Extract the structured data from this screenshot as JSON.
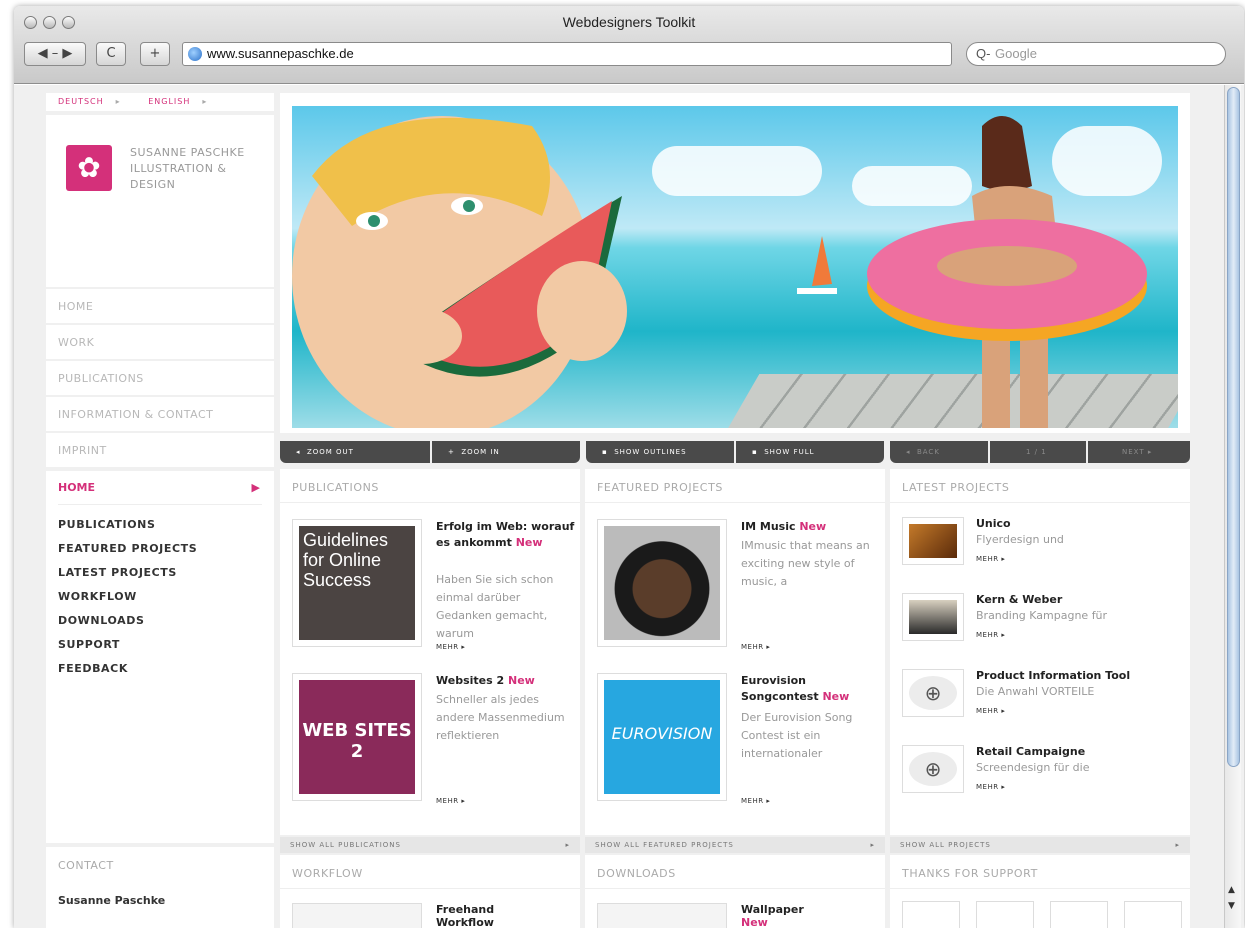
{
  "window": {
    "title": "Webdesigners Toolkit"
  },
  "browser": {
    "back_forward": "◀ – ▶",
    "reload": "C",
    "add": "+",
    "url": "www.susannepaschke.de",
    "search_placeholder": "Google",
    "search_prefix": "Q-"
  },
  "lang": {
    "de": "DEUTSCH",
    "en": "ENGLISH"
  },
  "logo": {
    "line1": "SUSANNE PASCHKE",
    "line2": "ILLUSTRATION &",
    "line3": "DESIGN"
  },
  "nav_main": [
    "HOME",
    "WORK",
    "PUBLICATIONS",
    "INFORMATION & CONTACT",
    "IMPRINT"
  ],
  "nav_sub": {
    "active": "HOME",
    "items": [
      "PUBLICATIONS",
      "FEATURED PROJECTS",
      "LATEST PROJECTS",
      "WORKFLOW",
      "DOWNLOADS",
      "SUPPORT",
      "FEEDBACK"
    ]
  },
  "contact": {
    "heading": "CONTACT",
    "name": "Susanne Paschke"
  },
  "hero_toolbar": {
    "zoom_out": "ZOOM OUT",
    "zoom_in": "ZOOM IN",
    "show_outlines": "SHOW OUTLINES",
    "show_full": "SHOW FULL",
    "prev": "BACK",
    "page": "1 / 1",
    "next": "NEXT"
  },
  "publications": {
    "heading": "PUBLICATIONS",
    "items": [
      {
        "title": "Erfolg im Web: worauf es ankommt",
        "badge": "New",
        "desc": "Haben Sie sich schon einmal darüber Gedanken gemacht, warum",
        "more": "MEHR ▸",
        "cover_text": "Guidelines for Online Success"
      },
      {
        "title": "Websites 2",
        "badge": "New",
        "desc": "Schneller als jedes andere Massenmedium reflektieren",
        "more": "MEHR ▸",
        "cover_text": "WEB SITES 2"
      }
    ],
    "show_all": "SHOW ALL PUBLICATIONS"
  },
  "featured": {
    "heading": "FEATURED PROJECTS",
    "items": [
      {
        "title": "IM Music",
        "badge": "New",
        "desc": "IMmusic that means an exciting new style of music, a",
        "more": "MEHR ▸"
      },
      {
        "title": "Eurovision Songcontest",
        "badge": "New",
        "desc": "Der Eurovision Song Contest ist ein internationaler",
        "more": "MEHR ▸",
        "cover_text": "EUROVISION"
      }
    ],
    "show_all": "SHOW ALL FEATURED PROJECTS"
  },
  "latest": {
    "heading": "LATEST PROJECTS",
    "items": [
      {
        "title": "Unico",
        "desc": "Flyerdesign und",
        "more": "MEHR ▸"
      },
      {
        "title": "Kern & Weber",
        "desc": "Branding Kampagne für",
        "more": "MEHR ▸"
      },
      {
        "title": "Product Information Tool",
        "desc": "Die Anwahl VORTEILE",
        "more": "MEHR ▸"
      },
      {
        "title": "Retail Campaigne",
        "desc": "Screendesign für die",
        "more": "MEHR ▸"
      }
    ],
    "show_all": "SHOW ALL PROJECTS"
  },
  "workflow": {
    "heading": "WORKFLOW",
    "item_title": "Freehand Workflow"
  },
  "downloads": {
    "heading": "DOWNLOADS",
    "item_title": "Wallpaper",
    "badge": "New"
  },
  "support": {
    "heading": "THANKS FOR SUPPORT"
  },
  "colors": {
    "accent": "#d4307a",
    "toolbar": "#4a4a4a"
  }
}
